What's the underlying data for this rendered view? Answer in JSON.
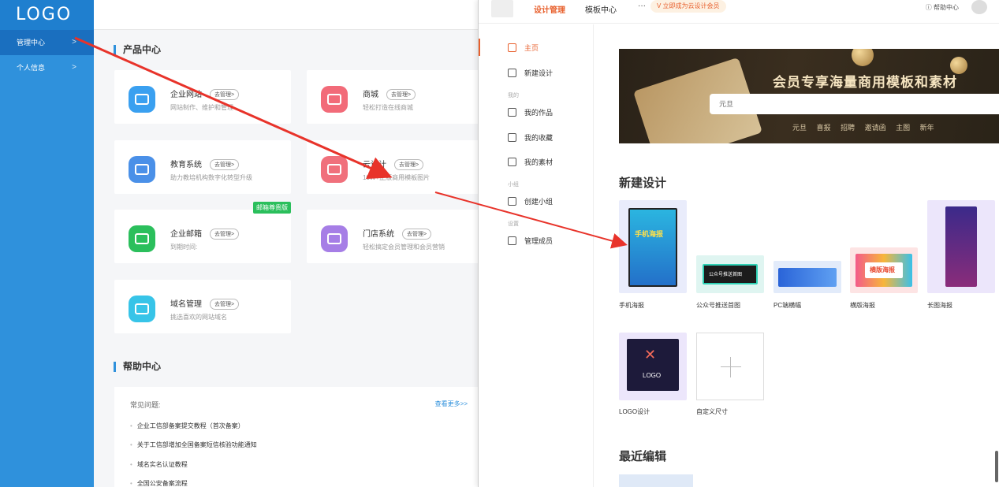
{
  "sidebar": {
    "logo": "LOGO",
    "items": [
      {
        "label": "管理中心",
        "chevron": ">"
      },
      {
        "label": "个人信息",
        "chevron": ">"
      }
    ]
  },
  "products": {
    "title": "产品中心",
    "manage_label": "去管理>",
    "cards": [
      {
        "title": "企业网站",
        "desc": "网站制作、维护和管理",
        "color": "#3aa0f0"
      },
      {
        "title": "商城",
        "desc": "轻松打造在线商城",
        "color": "#f26b79"
      },
      {
        "title": "教育系统",
        "desc": "助力教培机构数字化转型升级",
        "color": "#4a90e8"
      },
      {
        "title": "云设计",
        "desc": "10W+正版商用模板图片",
        "color": "#f0707c"
      },
      {
        "title": "企业邮箱",
        "desc": "到期时间:",
        "color": "#2bbf5c",
        "badge": "邮箱尊贵版"
      },
      {
        "title": "门店系统",
        "desc": "轻松搞定会员管理和会员营销",
        "color": "#a67ee6"
      },
      {
        "title": "域名管理",
        "desc": "挑选喜欢的网站域名",
        "color": "#37c4e8"
      }
    ]
  },
  "help": {
    "title": "帮助中心",
    "faq_label": "常见问题:",
    "more": "查看更多>>",
    "items": [
      "企业工信部备案提交教程（首次备案）",
      "关于工信部增加全国备案短信核验功能通知",
      "域名实名认证教程",
      "全国公安备案流程"
    ]
  },
  "design": {
    "nav": {
      "active": "设计管理",
      "templates": "模板中心",
      "more": "···",
      "vip": "V 立即成为云设计会员",
      "help": "帮助中心"
    },
    "side": {
      "home": "主页",
      "new": "新建设计",
      "group_mine": "我的",
      "works": "我的作品",
      "favorites": "我的收藏",
      "materials": "我的素材",
      "group_team": "小组",
      "create_team": "创建小组",
      "group_settings": "设置",
      "members": "管理成员"
    },
    "banner": {
      "title": "会员专享海量商用模板和素材",
      "search_value": "元旦",
      "tags": [
        "元旦",
        "喜报",
        "招聘",
        "邀请函",
        "主图",
        "新年"
      ]
    },
    "new_design_title": "新建设计",
    "templates": [
      {
        "name": "手机海报",
        "thumb_text": "手机海报"
      },
      {
        "name": "公众号推送首图",
        "thumb_text": "公众号推送首图"
      },
      {
        "name": "PC端横幅",
        "thumb_text": ""
      },
      {
        "name": "横版海报",
        "thumb_text": "横版海报"
      },
      {
        "name": "长图海报",
        "thumb_text": ""
      },
      {
        "name": "LOGO设计",
        "thumb_text": "LOGO"
      },
      {
        "name": "自定义尺寸",
        "thumb_text": ""
      }
    ],
    "recent_title": "最近编辑"
  },
  "colors": {
    "brand": "#2f91dc",
    "accent": "#e8602d",
    "arrow": "#e8332a"
  }
}
